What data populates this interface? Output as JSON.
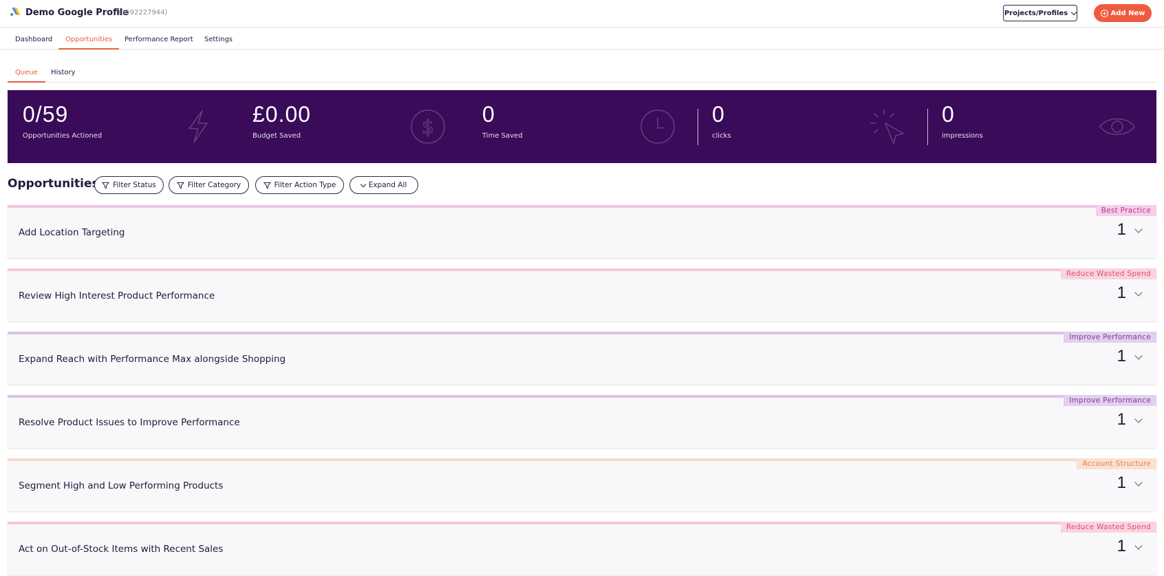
{
  "header": {
    "profile_title": "Demo Google Profile",
    "profile_id": "(3692227944)",
    "projects_label": "Projects/Profiles",
    "add_new_label": "Add New",
    "logo_icon": "google-ads-logo",
    "accent_color": "#f05a3f"
  },
  "main_nav": {
    "tabs": [
      {
        "label": "Dashboard",
        "active": false
      },
      {
        "label": "Opportunities",
        "active": true
      },
      {
        "label": "Performance Report",
        "active": false
      },
      {
        "label": "Settings",
        "active": false
      }
    ]
  },
  "sub_nav": {
    "tabs": [
      {
        "label": "Queue",
        "active": true
      },
      {
        "label": "History",
        "active": false
      }
    ]
  },
  "stats": {
    "background": "#3a0b58",
    "items": [
      {
        "value": "0/59",
        "label": "Opportunities Actioned",
        "icon": "lightning-icon"
      },
      {
        "value": "£0.00",
        "label": "Budget Saved",
        "icon": "dollar-icon"
      },
      {
        "value": "0",
        "label": "Time Saved",
        "icon": "clock-icon"
      },
      {
        "value": "0",
        "label": "clicks",
        "icon": "cursor-click-icon"
      },
      {
        "value": "0",
        "label": "impressions",
        "icon": "eye-icon"
      }
    ]
  },
  "opportunities": {
    "title": "Opportunities",
    "filters": [
      "Filter Status",
      "Filter Category",
      "Filter Action Type",
      "Expand All"
    ],
    "items": [
      {
        "title": "Add Location Targeting",
        "category": "Best Practice",
        "count": "1",
        "bar_color": "#f0c6e4",
        "badge_bg": "#f7cde9",
        "badge_color": "#b8378e"
      },
      {
        "title": "Review High Interest Product Performance",
        "category": "Reduce Wasted Spend",
        "count": "1",
        "bar_color": "#f6c9d5",
        "badge_bg": "#fad4de",
        "badge_color": "#d94f76"
      },
      {
        "title": "Expand Reach with Performance Max alongside Shopping",
        "category": "Improve Performance",
        "count": "1",
        "bar_color": "#dcc5e6",
        "badge_bg": "#e3cfee",
        "badge_color": "#7a3f9a"
      },
      {
        "title": "Resolve Product Issues to Improve Performance",
        "category": "Improve Performance",
        "count": "1",
        "bar_color": "#dcc5e6",
        "badge_bg": "#e3cfee",
        "badge_color": "#7a3f9a"
      },
      {
        "title": "Segment High and Low Performing Products",
        "category": "Account Structure",
        "count": "1",
        "bar_color": "#f8dccb",
        "badge_bg": "#fbe1d2",
        "badge_color": "#e0844b"
      },
      {
        "title": "Act on Out-of-Stock Items with Recent Sales",
        "category": "Reduce Wasted Spend",
        "count": "1",
        "bar_color": "#f6c9d5",
        "badge_bg": "#fad4de",
        "badge_color": "#d94f76"
      }
    ]
  }
}
